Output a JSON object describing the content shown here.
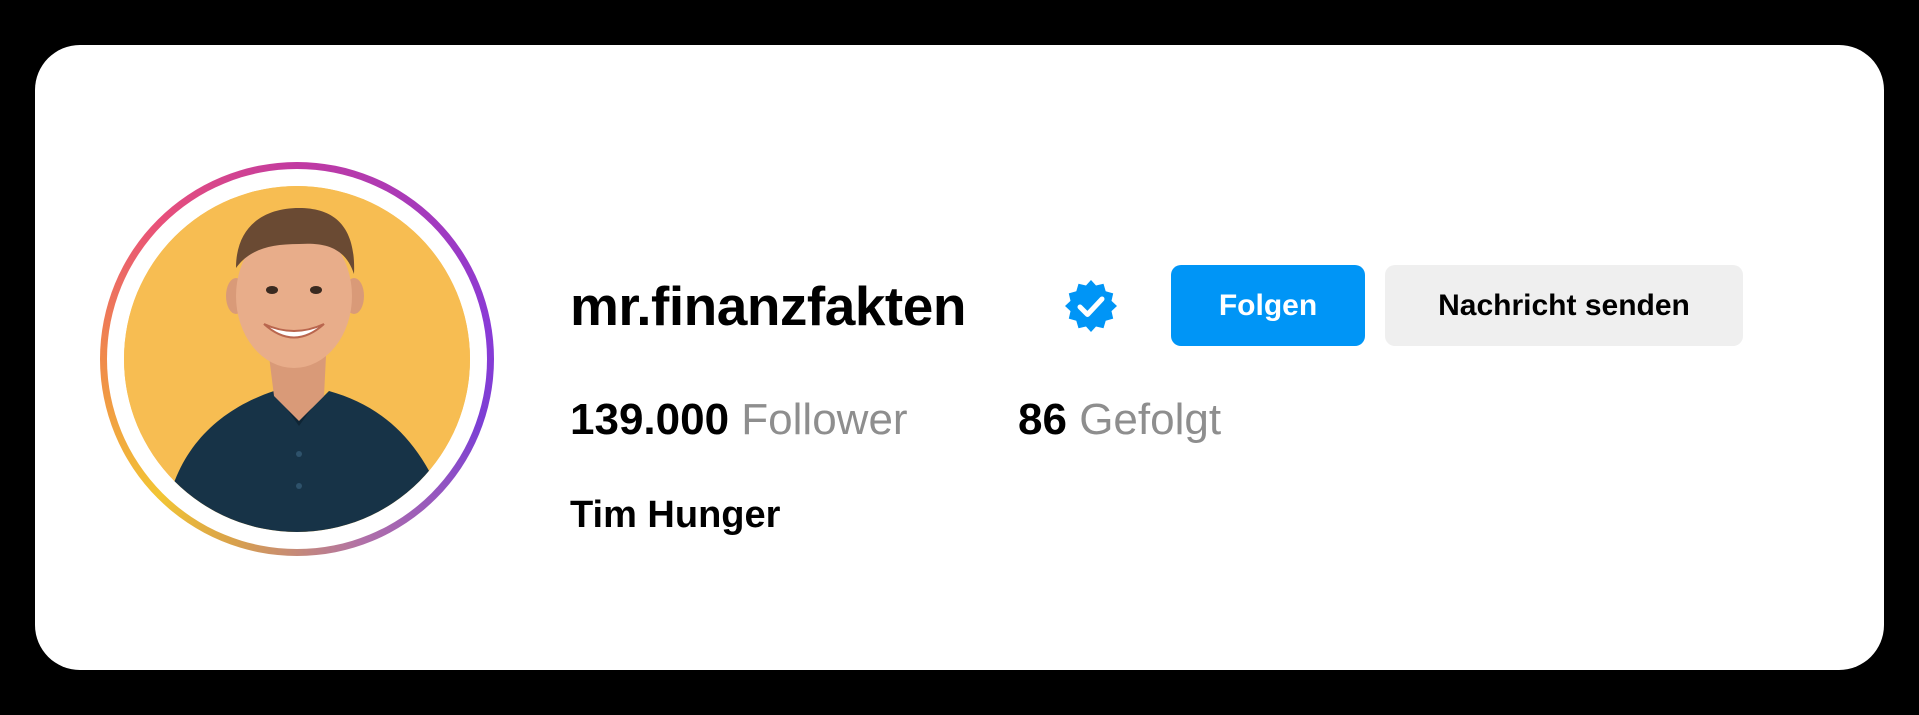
{
  "profile": {
    "username": "mr.finanzfakten",
    "verified_icon": "verified-badge-icon",
    "full_name": "Tim Hunger",
    "avatar_background": "#f7bd52"
  },
  "actions": {
    "follow_label": "Folgen",
    "message_label": "Nachricht senden"
  },
  "stats": {
    "followers_count": "139.000",
    "followers_label": "Follower",
    "following_count": "86",
    "following_label": "Gefolgt"
  },
  "colors": {
    "accent": "#0095f6",
    "verified": "#0095f6",
    "secondary_text": "#8e8e8e",
    "secondary_button": "#efefef"
  }
}
